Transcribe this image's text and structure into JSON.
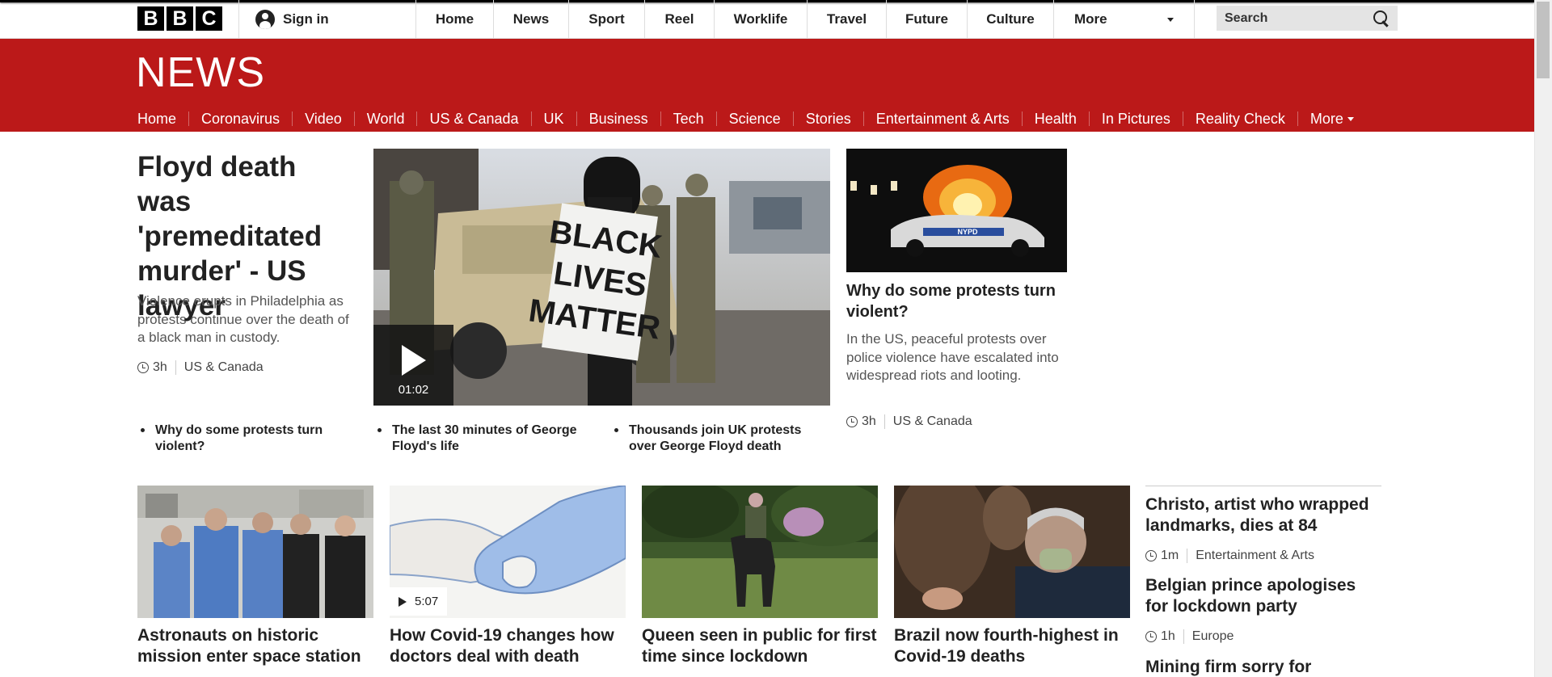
{
  "masthead": {
    "logo_letters": [
      "B",
      "B",
      "C"
    ],
    "sign_in": "Sign in",
    "nav": [
      "Home",
      "News",
      "Sport",
      "Reel",
      "Worklife",
      "Travel",
      "Future",
      "Culture"
    ],
    "more": "More",
    "search_label": "Search"
  },
  "news": {
    "logo": "NEWS",
    "nav": [
      "Home",
      "Coronavirus",
      "Video",
      "World",
      "US & Canada",
      "UK",
      "Business",
      "Tech",
      "Science",
      "Stories",
      "Entertainment & Arts",
      "Health",
      "In Pictures",
      "Reality Check"
    ],
    "more": "More",
    "active": "Home"
  },
  "lead": {
    "title": "Floyd death was 'premeditated murder' - US lawyer",
    "summary": "Violence erupts in Philadelphia as protests continue over the death of a black man in custody.",
    "time": "3h",
    "section": "US & Canada",
    "image_sign": [
      "BLACK",
      "LIVES",
      "MATTER"
    ],
    "video_duration": "01:02",
    "related": [
      "Why do some protests turn violent?",
      "The last 30 minutes of George Floyd's life",
      "Thousands join UK protests over George Floyd death"
    ]
  },
  "side_story": {
    "image_text": "NYPD",
    "title": "Why do some protests turn violent?",
    "summary": "In the US, peaceful protests over police violence have escalated into widespread riots and looting.",
    "time": "3h",
    "section": "US & Canada"
  },
  "cards": [
    {
      "title": "Astronauts on historic mission enter space station"
    },
    {
      "title": "How Covid-19 changes how doctors deal with death",
      "video_duration": "5:07"
    },
    {
      "title": "Queen seen in public for first time since lockdown"
    },
    {
      "title": "Brazil now fourth-highest in Covid-19 deaths"
    }
  ],
  "right_list": [
    {
      "title": "Christo, artist who wrapped landmarks, dies at 84",
      "time": "1m",
      "section": "Entertainment & Arts"
    },
    {
      "title": "Belgian prince apologises for lockdown party",
      "time": "1h",
      "section": "Europe"
    },
    {
      "title": "Mining firm sorry for"
    }
  ],
  "colors": {
    "brand_red": "#bb1919",
    "text": "#222222",
    "summary": "#555555"
  }
}
